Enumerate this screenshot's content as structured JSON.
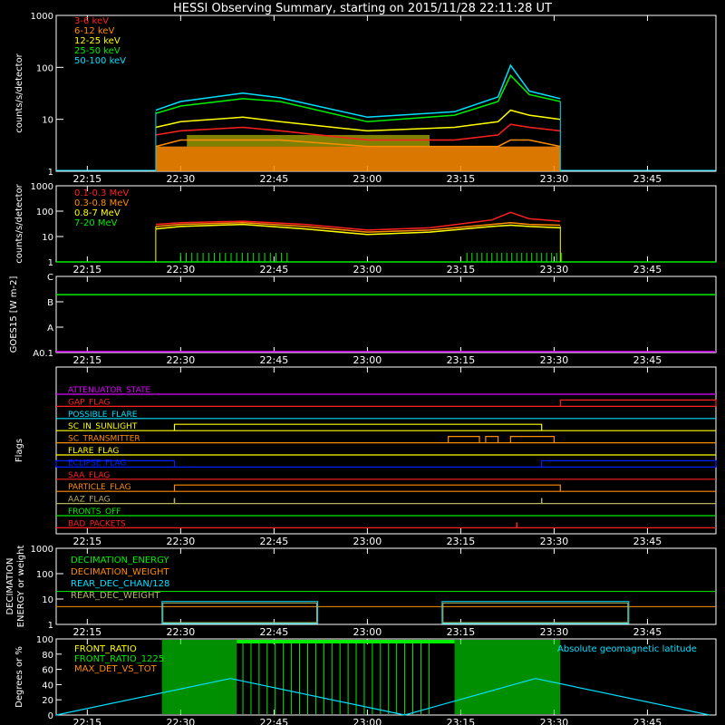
{
  "title": "HESSI Observing Summary, starting on 2015/11/28 22:11:28 UT",
  "time_ticks": [
    "22:15",
    "22:30",
    "22:45",
    "23:00",
    "23:15",
    "23:30",
    "23:45"
  ],
  "colors": {
    "red": "#ff2020",
    "orange": "#ff8c00",
    "yellow": "#ffff00",
    "green": "#00ee00",
    "cyan": "#00e0ff",
    "magenta": "#dd00ff",
    "blue": "#0020ff",
    "olive": "#b8b060",
    "white": "#ffffff"
  },
  "chart_data": [
    {
      "id": "p1",
      "type": "line",
      "ylabel": "counts/s/detector",
      "yscale": "log",
      "ytick_labels": [
        "1",
        "10",
        "100",
        "1000"
      ],
      "ylim": [
        1,
        1000
      ],
      "legend": [
        "3-6 keV",
        "6-12 keV",
        "12-25 keV",
        "25-50 keV",
        "50-100 keV"
      ],
      "legend_colors": [
        "red",
        "orange",
        "yellow",
        "green",
        "cyan"
      ],
      "series": [
        {
          "name": "3-6 keV",
          "color": "red",
          "x": [
            "22:26",
            "22:30",
            "22:40",
            "22:46",
            "23:00",
            "23:14",
            "23:21",
            "23:23",
            "23:26",
            "23:31"
          ],
          "y": [
            5,
            6,
            7,
            6,
            4,
            4,
            5,
            8,
            7,
            6
          ]
        },
        {
          "name": "6-12 keV",
          "color": "orange",
          "x": [
            "22:26",
            "22:30",
            "22:40",
            "22:46",
            "23:00",
            "23:14",
            "23:21",
            "23:23",
            "23:26",
            "23:31"
          ],
          "y": [
            3,
            4,
            4,
            4,
            3,
            3,
            3,
            4,
            4,
            3
          ]
        },
        {
          "name": "12-25 keV",
          "color": "yellow",
          "x": [
            "22:26",
            "22:30",
            "22:40",
            "22:46",
            "23:00",
            "23:14",
            "23:21",
            "23:23",
            "23:26",
            "23:31"
          ],
          "y": [
            7,
            9,
            11,
            9,
            6,
            7,
            9,
            15,
            12,
            10
          ]
        },
        {
          "name": "25-50 keV",
          "color": "green",
          "x": [
            "22:26",
            "22:30",
            "22:40",
            "22:46",
            "23:00",
            "23:14",
            "23:21",
            "23:23",
            "23:26",
            "23:31"
          ],
          "y": [
            13,
            18,
            25,
            22,
            9,
            12,
            22,
            70,
            30,
            22
          ]
        },
        {
          "name": "50-100 keV",
          "color": "cyan",
          "x": [
            "22:26",
            "22:30",
            "22:40",
            "22:46",
            "23:00",
            "23:14",
            "23:21",
            "23:23",
            "23:26",
            "23:31"
          ],
          "y": [
            15,
            22,
            32,
            26,
            11,
            14,
            27,
            110,
            35,
            25
          ]
        }
      ]
    },
    {
      "id": "p2",
      "type": "line",
      "ylabel": "counts/s/detector",
      "yscale": "log",
      "ytick_labels": [
        "1",
        "10",
        "100",
        "1000"
      ],
      "ylim": [
        1,
        1000
      ],
      "legend": [
        "0.1-0.3 MeV",
        "0.3-0.8 MeV",
        "0.8-7 MeV",
        "7-20 MeV"
      ],
      "legend_colors": [
        "red",
        "orange",
        "yellow",
        "green"
      ],
      "series": [
        {
          "name": "0.1-0.3 MeV",
          "color": "red",
          "x": [
            "22:26",
            "22:30",
            "22:40",
            "22:50",
            "23:00",
            "23:10",
            "23:20",
            "23:23",
            "23:26",
            "23:31"
          ],
          "y": [
            30,
            35,
            40,
            30,
            18,
            22,
            45,
            90,
            50,
            40
          ]
        },
        {
          "name": "0.3-0.8 MeV",
          "color": "orange",
          "x": [
            "22:26",
            "22:30",
            "22:40",
            "22:50",
            "23:00",
            "23:10",
            "23:20",
            "23:23",
            "23:26",
            "23:31"
          ],
          "y": [
            25,
            30,
            35,
            25,
            15,
            18,
            30,
            35,
            30,
            28
          ]
        },
        {
          "name": "0.8-7 MeV",
          "color": "yellow",
          "x": [
            "22:26",
            "22:30",
            "22:40",
            "22:50",
            "23:00",
            "23:10",
            "23:20",
            "23:23",
            "23:26",
            "23:31"
          ],
          "y": [
            20,
            25,
            30,
            20,
            12,
            15,
            25,
            28,
            25,
            22
          ]
        },
        {
          "name": "7-20 MeV",
          "color": "green",
          "x": [
            "22:10",
            "23:56"
          ],
          "y": [
            1,
            1
          ]
        }
      ]
    },
    {
      "id": "p3",
      "type": "line",
      "ylabel": "GOES15 [W m-2]",
      "yscale": "log",
      "ytick_labels": [
        "A0.1",
        "A",
        "B",
        "C"
      ],
      "series": [
        {
          "name": "GOES15",
          "color": "green",
          "x": [
            "22:10",
            "23:56"
          ],
          "y": [
            "B1.4",
            "B1.4"
          ]
        }
      ]
    },
    {
      "id": "p4",
      "type": "flags",
      "ylabel": "Flags",
      "flags": [
        {
          "name": "ATTENUATOR_STATE",
          "color": "magenta",
          "segments": []
        },
        {
          "name": "GAP_FLAG",
          "color": "red",
          "segments": [
            [
              "23:31",
              "23:56"
            ]
          ]
        },
        {
          "name": "POSSIBLE_FLARE",
          "color": "cyan",
          "segments": []
        },
        {
          "name": "SC_IN_SUNLIGHT",
          "color": "yellow",
          "segments": [
            [
              "22:29",
              "23:28"
            ]
          ]
        },
        {
          "name": "SC_TRANSMITTER",
          "color": "orange",
          "segments": [
            [
              "23:13",
              "23:18"
            ],
            [
              "23:19",
              "23:21"
            ],
            [
              "23:23",
              "23:30"
            ]
          ]
        },
        {
          "name": "FLARE_FLAG",
          "color": "yellow",
          "segments": []
        },
        {
          "name": "ECLIPSE_FLAG",
          "color": "blue",
          "segments": [
            [
              "22:10",
              "22:29"
            ],
            [
              "23:28",
              "23:56"
            ]
          ]
        },
        {
          "name": "SAA_FLAG",
          "color": "red",
          "segments": []
        },
        {
          "name": "PARTICLE_FLAG",
          "color": "orange",
          "segments": [
            [
              "22:29",
              "23:31"
            ]
          ]
        },
        {
          "name": "AAZ_FLAG",
          "color": "olive",
          "segments": [
            [
              "22:29",
              "22:29"
            ],
            [
              "23:28",
              "23:28"
            ]
          ]
        },
        {
          "name": "FRONTS_OFF",
          "color": "green",
          "segments": []
        },
        {
          "name": "BAD_PACKETS",
          "color": "red",
          "segments": [
            [
              "23:24",
              "23:24"
            ]
          ]
        }
      ]
    },
    {
      "id": "p5",
      "type": "line",
      "ylabel": "DECIMATION ENERGY or weight",
      "yscale": "log",
      "ytick_labels": [
        "1",
        "10",
        "100",
        "1000"
      ],
      "ylim": [
        1,
        1000
      ],
      "legend": [
        "DECIMATION_ENERGY",
        "DECIMATION_WEIGHT",
        "REAR_DEC_CHAN/128",
        "REAR_DEC_WEIGHT"
      ],
      "legend_colors": [
        "green",
        "orange",
        "cyan",
        "olive"
      ]
    },
    {
      "id": "p6",
      "type": "line",
      "ylabel": "Degrees or %",
      "ytick_labels": [
        "0",
        "20",
        "40",
        "60",
        "80",
        "100"
      ],
      "ylim": [
        0,
        100
      ],
      "legend": [
        "FRONT_RATIO",
        "FRONT_RATIO_1225",
        "MAX_DET_VS_TOT"
      ],
      "legend_colors": [
        "yellow",
        "green",
        "orange"
      ],
      "annotation": "Absolute geomagnetic latitude",
      "series": [
        {
          "name": "Absolute geomagnetic latitude",
          "color": "cyan",
          "x": [
            "22:10",
            "22:38",
            "23:06",
            "23:27",
            "23:55"
          ],
          "y": [
            0,
            48,
            0,
            48,
            0
          ]
        }
      ]
    }
  ]
}
